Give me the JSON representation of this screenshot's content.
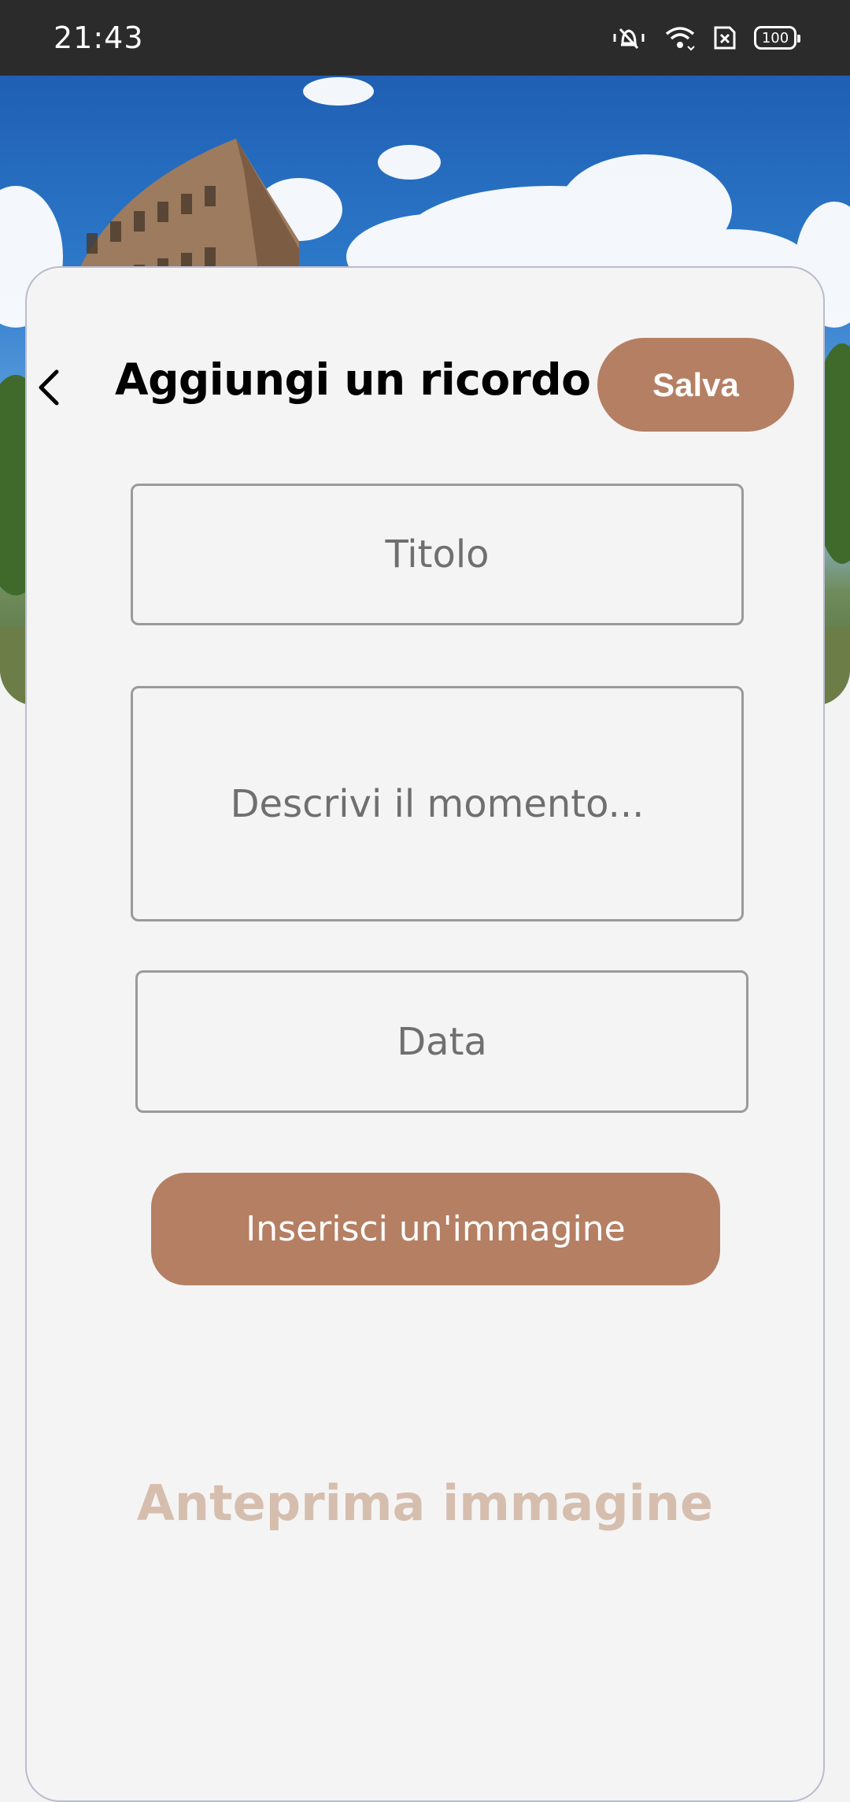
{
  "status_bar": {
    "time": "21:43",
    "icons": [
      "vibrate-silent-icon",
      "wifi-icon",
      "no-sim-icon",
      "battery-icon"
    ],
    "battery_level": "100"
  },
  "header": {
    "image": "colosseum-photo"
  },
  "toolbar": {
    "back_icon": "chevron-left-icon",
    "title": "Aggiungi un ricordo",
    "save_label": "Salva"
  },
  "form": {
    "title_placeholder": "Titolo",
    "description_placeholder": "Descrivi il momento...",
    "date_placeholder": "Data",
    "insert_image_label": "Inserisci un'immagine"
  },
  "preview": {
    "label": "Anteprima immagine"
  },
  "colors": {
    "accent": "#b57f63",
    "preview_text": "#d6beae",
    "card_background": "#f4f4f4",
    "status_bar": "#2b2b2b"
  }
}
